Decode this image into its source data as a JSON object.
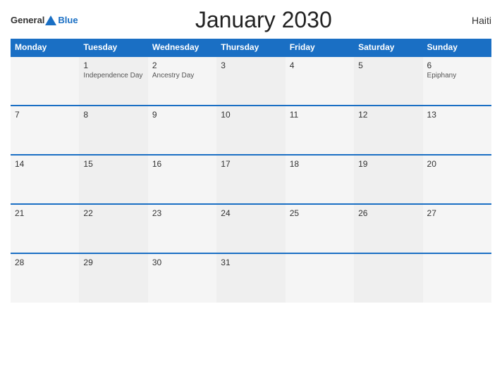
{
  "header": {
    "logo_general": "General",
    "logo_blue": "Blue",
    "title": "January 2030",
    "country": "Haiti"
  },
  "days_of_week": [
    "Monday",
    "Tuesday",
    "Wednesday",
    "Thursday",
    "Friday",
    "Saturday",
    "Sunday"
  ],
  "weeks": [
    [
      {
        "day": "",
        "event": ""
      },
      {
        "day": "1",
        "event": "Independence Day"
      },
      {
        "day": "2",
        "event": "Ancestry Day"
      },
      {
        "day": "3",
        "event": ""
      },
      {
        "day": "4",
        "event": ""
      },
      {
        "day": "5",
        "event": ""
      },
      {
        "day": "6",
        "event": "Epiphany"
      }
    ],
    [
      {
        "day": "7",
        "event": ""
      },
      {
        "day": "8",
        "event": ""
      },
      {
        "day": "9",
        "event": ""
      },
      {
        "day": "10",
        "event": ""
      },
      {
        "day": "11",
        "event": ""
      },
      {
        "day": "12",
        "event": ""
      },
      {
        "day": "13",
        "event": ""
      }
    ],
    [
      {
        "day": "14",
        "event": ""
      },
      {
        "day": "15",
        "event": ""
      },
      {
        "day": "16",
        "event": ""
      },
      {
        "day": "17",
        "event": ""
      },
      {
        "day": "18",
        "event": ""
      },
      {
        "day": "19",
        "event": ""
      },
      {
        "day": "20",
        "event": ""
      }
    ],
    [
      {
        "day": "21",
        "event": ""
      },
      {
        "day": "22",
        "event": ""
      },
      {
        "day": "23",
        "event": ""
      },
      {
        "day": "24",
        "event": ""
      },
      {
        "day": "25",
        "event": ""
      },
      {
        "day": "26",
        "event": ""
      },
      {
        "day": "27",
        "event": ""
      }
    ],
    [
      {
        "day": "28",
        "event": ""
      },
      {
        "day": "29",
        "event": ""
      },
      {
        "day": "30",
        "event": ""
      },
      {
        "day": "31",
        "event": ""
      },
      {
        "day": "",
        "event": ""
      },
      {
        "day": "",
        "event": ""
      },
      {
        "day": "",
        "event": ""
      }
    ]
  ]
}
